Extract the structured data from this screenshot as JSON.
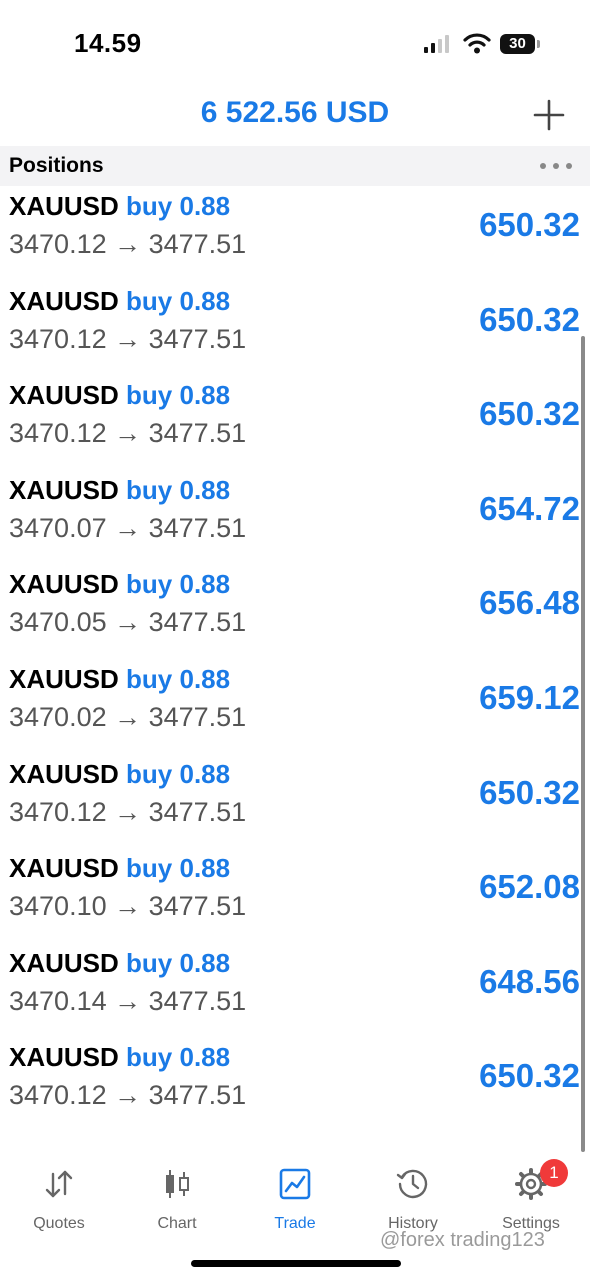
{
  "status_bar": {
    "time": "14.59",
    "battery": "30"
  },
  "header": {
    "balance": "6 522.56 USD"
  },
  "positions": {
    "title": "Positions",
    "rows": [
      {
        "symbol": "XAUUSD",
        "side": "buy 0.88",
        "prices": "3470.12 → 3477.51",
        "profit": "650.32"
      },
      {
        "symbol": "XAUUSD",
        "side": "buy 0.88",
        "prices": "3470.12 → 3477.51",
        "profit": "650.32"
      },
      {
        "symbol": "XAUUSD",
        "side": "buy 0.88",
        "prices": "3470.12 → 3477.51",
        "profit": "650.32"
      },
      {
        "symbol": "XAUUSD",
        "side": "buy 0.88",
        "prices": "3470.07 → 3477.51",
        "profit": "654.72"
      },
      {
        "symbol": "XAUUSD",
        "side": "buy 0.88",
        "prices": "3470.05 → 3477.51",
        "profit": "656.48"
      },
      {
        "symbol": "XAUUSD",
        "side": "buy 0.88",
        "prices": "3470.02 → 3477.51",
        "profit": "659.12"
      },
      {
        "symbol": "XAUUSD",
        "side": "buy 0.88",
        "prices": "3470.12 → 3477.51",
        "profit": "650.32"
      },
      {
        "symbol": "XAUUSD",
        "side": "buy 0.88",
        "prices": "3470.10 → 3477.51",
        "profit": "652.08"
      },
      {
        "symbol": "XAUUSD",
        "side": "buy 0.88",
        "prices": "3470.14 → 3477.51",
        "profit": "648.56"
      },
      {
        "symbol": "XAUUSD",
        "side": "buy 0.88",
        "prices": "3470.12 → 3477.51",
        "profit": "650.32"
      }
    ]
  },
  "tabbar": {
    "tabs": [
      {
        "label": "Quotes",
        "icon": "quotes-arrows-icon"
      },
      {
        "label": "Chart",
        "icon": "candlestick-icon"
      },
      {
        "label": "Trade",
        "icon": "trade-chart-icon",
        "active": true
      },
      {
        "label": "History",
        "icon": "history-clock-icon"
      },
      {
        "label": "Settings",
        "icon": "gear-icon"
      }
    ],
    "settings_badge": "1"
  },
  "watermark": "@forex trading123",
  "colors": {
    "accent": "#1a7ae6",
    "badge": "#f03a3a",
    "section_bg": "#f3f3f5"
  }
}
